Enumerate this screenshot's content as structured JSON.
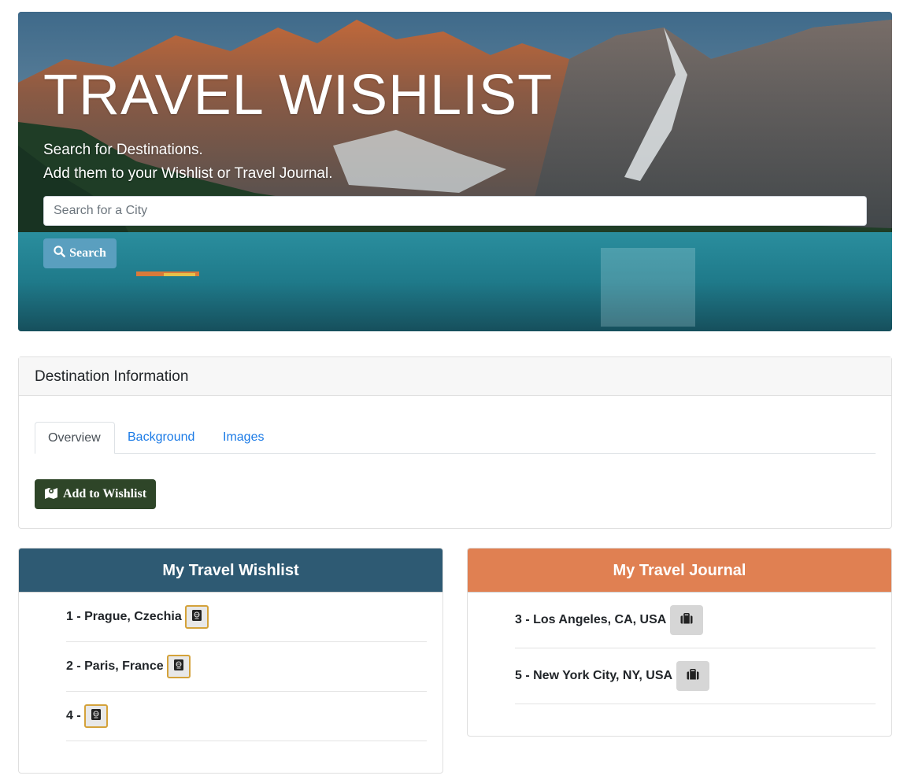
{
  "hero": {
    "title": "TRAVEL WISHLIST",
    "subtitle_line1": "Search for Destinations.",
    "subtitle_line2": "Add them to your Wishlist or Travel Journal.",
    "search_placeholder": "Search for a City",
    "search_button_label": "Search",
    "search_button_color": "#5a9fbf"
  },
  "destination": {
    "header": "Destination Information",
    "tabs": [
      {
        "label": "Overview",
        "active": true
      },
      {
        "label": "Background",
        "active": false
      },
      {
        "label": "Images",
        "active": false
      }
    ],
    "add_button_label": "Add to Wishlist",
    "add_button_color": "#2e4528"
  },
  "wishlist": {
    "title": "My Travel Wishlist",
    "header_color": "#2e5a73",
    "items": [
      {
        "label": "1 - Prague, Czechia",
        "icon": "passport-icon"
      },
      {
        "label": "2 - Paris, France",
        "icon": "passport-icon"
      },
      {
        "label": "4 -",
        "icon": "passport-icon"
      }
    ]
  },
  "journal": {
    "title": "My Travel Journal",
    "header_color": "#e08052",
    "items": [
      {
        "label": "3 - Los Angeles, CA, USA",
        "icon": "suitcase-icon"
      },
      {
        "label": "5 - New York City, NY, USA",
        "icon": "suitcase-icon"
      }
    ]
  }
}
